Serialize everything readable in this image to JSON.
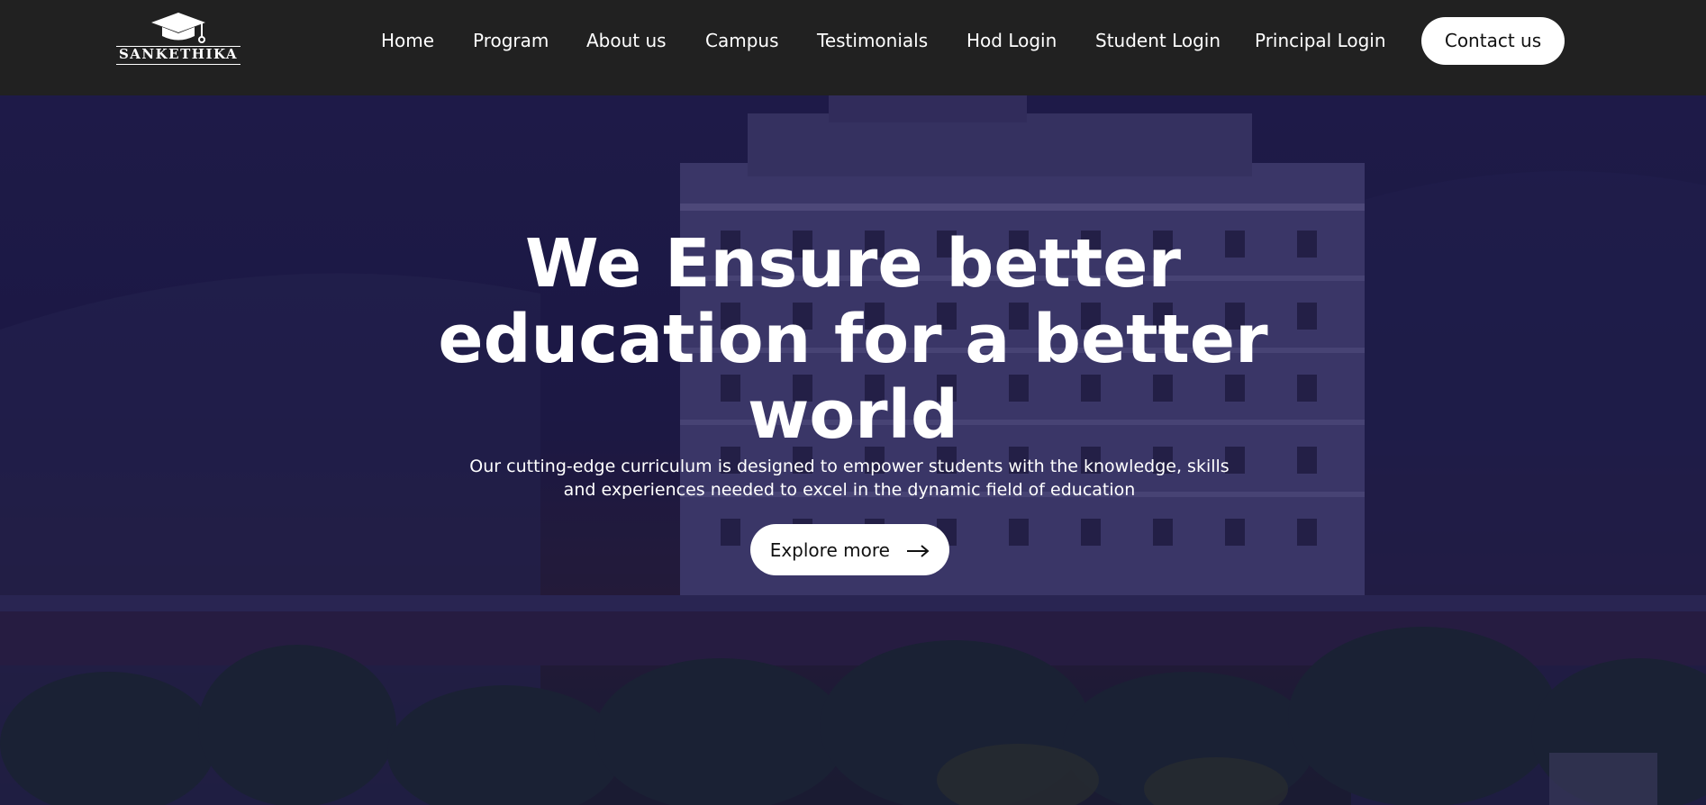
{
  "brand": {
    "name": "SANKETHIKA",
    "icon": "graduation-cap-icon"
  },
  "nav": {
    "items": [
      {
        "label": "Home"
      },
      {
        "label": "Program"
      },
      {
        "label": "About us"
      },
      {
        "label": "Campus"
      },
      {
        "label": "Testimonials"
      },
      {
        "label": "Hod Login"
      },
      {
        "label": "Student Login"
      },
      {
        "label": "Principal Login"
      }
    ],
    "contact_label": "Contact us"
  },
  "hero": {
    "title": "We Ensure better education for a better world",
    "subtitle": "Our cutting-edge curriculum is designed to empower students with the knowledge, skills and experiences needed to excel in the dynamic field of education",
    "cta_label": "Explore more",
    "cta_icon": "arrow-right-icon"
  },
  "colors": {
    "navbar_bg": "#212121",
    "hero_overlay": "#1f1c44",
    "button_bg": "#ffffff",
    "text_light": "#ffffff"
  }
}
